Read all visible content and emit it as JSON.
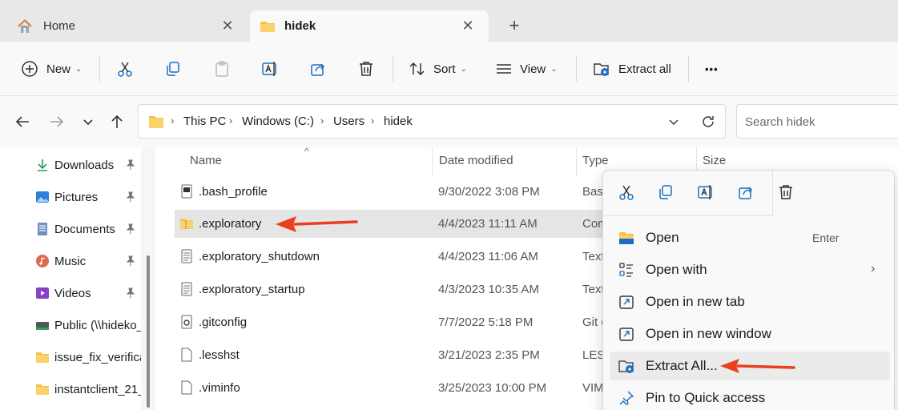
{
  "tabs": [
    {
      "label": "Home",
      "icon": "home-icon"
    },
    {
      "label": "hidek",
      "icon": "folder-icon"
    }
  ],
  "toolbar": {
    "new_label": "New",
    "sort_label": "Sort",
    "view_label": "View",
    "extract_label": "Extract all",
    "more_label": "•••"
  },
  "breadcrumb": [
    "This PC",
    "Windows (C:)",
    "Users",
    "hidek"
  ],
  "search": {
    "placeholder": "Search hidek"
  },
  "nav": [
    {
      "label": "Downloads",
      "icon": "download-icon",
      "pinned": true
    },
    {
      "label": "Pictures",
      "icon": "pictures-icon",
      "pinned": true
    },
    {
      "label": "Documents",
      "icon": "documents-icon",
      "pinned": true
    },
    {
      "label": "Music",
      "icon": "music-icon",
      "pinned": true
    },
    {
      "label": "Videos",
      "icon": "videos-icon",
      "pinned": true
    },
    {
      "label": "Public (\\\\hideko_",
      "icon": "network-drive-icon",
      "pinned": false
    },
    {
      "label": "issue_fix_verifica",
      "icon": "folder-icon",
      "pinned": false
    },
    {
      "label": "instantclient_21_",
      "icon": "folder-icon",
      "pinned": false
    }
  ],
  "columns": {
    "name": "Name",
    "date": "Date modified",
    "type": "Type",
    "size": "Size"
  },
  "files": [
    {
      "name": ".bash_profile",
      "date": "9/30/2022 3:08 PM",
      "type": "Bas"
    },
    {
      "name": ".exploratory",
      "date": "4/4/2023 11:11 AM",
      "type": "Com"
    },
    {
      "name": ".exploratory_shutdown",
      "date": "4/4/2023 11:06 AM",
      "type": "Text"
    },
    {
      "name": ".exploratory_startup",
      "date": "4/3/2023 10:35 AM",
      "type": "Text"
    },
    {
      "name": ".gitconfig",
      "date": "7/7/2022 5:18 PM",
      "type": "Git c"
    },
    {
      "name": ".lesshst",
      "date": "3/21/2023 2:35 PM",
      "type": "LES"
    },
    {
      "name": ".viminfo",
      "date": "3/25/2023 10:00 PM",
      "type": "VIM"
    }
  ],
  "context_menu": {
    "items": [
      {
        "label": "Open",
        "shortcut": "Enter"
      },
      {
        "label": "Open with",
        "has_submenu": true
      },
      {
        "label": "Open in new tab"
      },
      {
        "label": "Open in new window"
      },
      {
        "label": "Extract All..."
      },
      {
        "label": "Pin to Quick access"
      }
    ]
  },
  "colors": {
    "accent": "#0067c0",
    "annotation": "#e8401f",
    "folder": "#f6c244",
    "selected": "#e5e5e5"
  }
}
